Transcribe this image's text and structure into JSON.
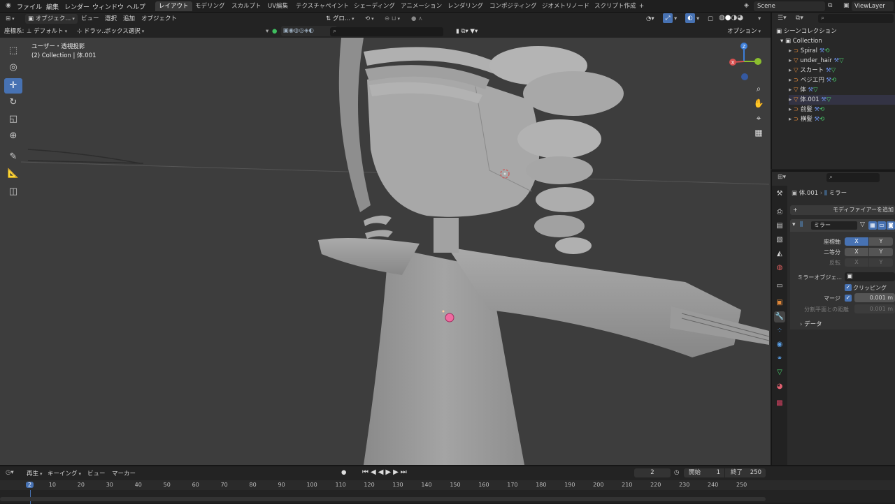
{
  "menubar": {
    "items": [
      "ファイル",
      "編集",
      "レンダー",
      "ウィンドウ",
      "ヘルプ"
    ],
    "workspaces": [
      "レイアウト",
      "モデリング",
      "スカルプト",
      "UV編集",
      "テクスチャペイント",
      "シェーディング",
      "アニメーション",
      "レンダリング",
      "コンポジティング",
      "ジオメトリノード",
      "スクリプト作成"
    ],
    "active_workspace": "レイアウト",
    "add_workspace": "+",
    "scene": "Scene",
    "viewlayer": "ViewLayer"
  },
  "viewport_header": {
    "mode": "オブジェク...",
    "view": "ビュー",
    "select": "選択",
    "add": "追加",
    "object": "オブジェクト",
    "orientation_label": "座標系:",
    "orientation_value": "デフォルト",
    "drag_label": "ドラッ...",
    "select_mode": "ボックス選択",
    "transform_global": "グロ...",
    "options": "オプション"
  },
  "viewport": {
    "view_name": "ユーザー・透視投影",
    "collection_info": "(2) Collection | 体.001",
    "gizmo": {
      "x": "X",
      "y": "Y",
      "z": "Z"
    }
  },
  "outliner": {
    "root": "シーンコレクション",
    "collection": "Collection",
    "items": [
      {
        "name": "Spiral",
        "type": "curve"
      },
      {
        "name": "under_hair",
        "type": "mesh"
      },
      {
        "name": "スカート",
        "type": "mesh"
      },
      {
        "name": "ベジエ円",
        "type": "curve"
      },
      {
        "name": "体",
        "type": "mesh"
      },
      {
        "name": "体.001",
        "type": "mesh"
      },
      {
        "name": "前髪",
        "type": "curve"
      },
      {
        "name": "横髪",
        "type": "curve"
      }
    ]
  },
  "properties": {
    "breadcrumb_object": "体.001",
    "breadcrumb_modifier": "ミラー",
    "add_modifier": "モディファイアーを追加",
    "modifier_name": "ミラー",
    "axis_label": "座標軸",
    "bisect_label": "二等分",
    "flip_label": "反転",
    "axes": [
      "X",
      "Y"
    ],
    "mirror_object_label": "ミラーオブジェ...",
    "clipping_label": "クリッピング",
    "merge_label": "マージ",
    "merge_value": "0.001 m",
    "bisect_distance_label": "分割平面との距離",
    "bisect_distance_value": "0.001 m",
    "data_panel": "データ"
  },
  "timeline": {
    "playback": "再生",
    "keying": "キーイング",
    "view": "ビュー",
    "marker": "マーカー",
    "current_frame": "2",
    "start_label": "開始",
    "start_value": "1",
    "end_label": "終了",
    "end_value": "250",
    "ruler": [
      2,
      10,
      20,
      30,
      40,
      50,
      60,
      70,
      80,
      90,
      100,
      110,
      120,
      130,
      140,
      150,
      160,
      170,
      180,
      190,
      200,
      210,
      220,
      230,
      240,
      250
    ]
  },
  "colors": {
    "accent": "#4772b3",
    "viewport_bg": "#3d3d3d",
    "mesh_icon": "#e0883a",
    "curve_icon": "#e0883a",
    "modifier_wrench": "#5aa0e8",
    "vertex_group": "#4bd16e"
  }
}
